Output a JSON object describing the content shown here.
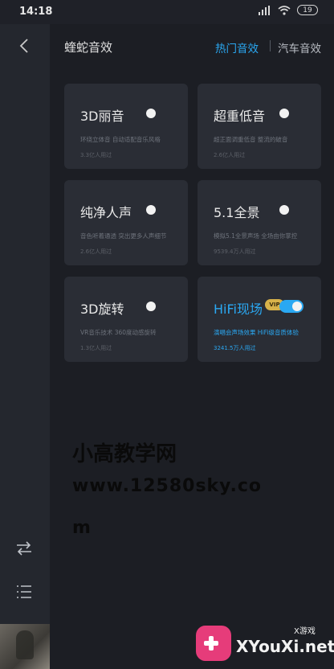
{
  "status": {
    "time": "14:18",
    "battery": "19"
  },
  "header": {
    "title": "蝰蛇音效",
    "tab_hot": "热门音效",
    "tab_car": "汽车音效"
  },
  "cards": [
    {
      "title": "3D丽音",
      "desc": "环绕立体音 自动适配音乐风格",
      "count": "3.3亿人用过",
      "on": false
    },
    {
      "title": "超重低音",
      "desc": "超正面调重低音 整流的破音",
      "count": "2.6亿人用过",
      "on": false
    },
    {
      "title": "纯净人声",
      "desc": "音色听着通透 突出更多人声细节",
      "count": "2.6亿人用过",
      "on": false
    },
    {
      "title": "5.1全景",
      "desc": "模拟5.1全景声场 全场由你掌控",
      "count": "9539.4万人用过",
      "on": false
    },
    {
      "title": "3D旋转",
      "desc": "VR音乐技术 360度动感旋转",
      "count": "1.3亿人用过",
      "on": false
    },
    {
      "title": "HiFi现场",
      "badge": "VIP",
      "desc": "演唱会声场效果 HiFi级音质体验",
      "count": "3241.5万人用过",
      "on": true
    }
  ],
  "watermark": {
    "line1": "小高教学网",
    "line2": "www.12580sky.co",
    "line3": "m"
  },
  "logo": {
    "text": "XYouXi.net",
    "small": "X游戏"
  },
  "colors": {
    "accent": "#2aa8f2",
    "card_bg": "#2a2d35",
    "page_bg": "#1c1e24"
  }
}
